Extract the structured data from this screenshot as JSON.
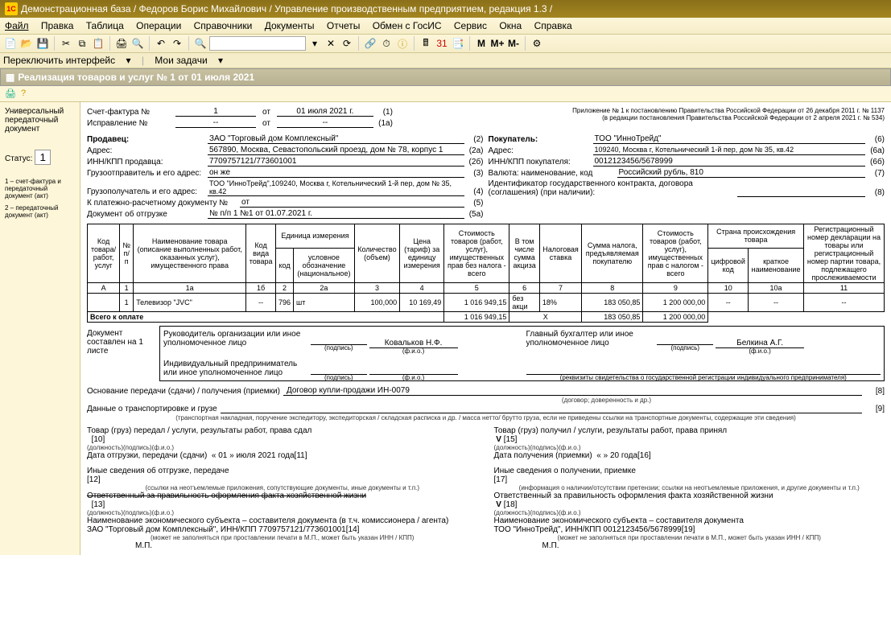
{
  "app_title": "Демонстрационная база / Федоров Борис Михайлович / Управление производственным предприятием, редакция 1.3 /",
  "menu": [
    "Файл",
    "Правка",
    "Таблица",
    "Операции",
    "Справочники",
    "Документы",
    "Отчеты",
    "Обмен с ГосИС",
    "Сервис",
    "Окна",
    "Справка"
  ],
  "tabs": {
    "a": "Переключить интерфейс",
    "b": "Мои задачи"
  },
  "form_title": "Реализация товаров и услуг № 1 от 01 июля 2021",
  "left": {
    "l1": "Универсальный передаточный документ",
    "status_lbl": "Статус:",
    "status_val": "1",
    "n1": "1 – счет-фактура и передаточный документ (акт)",
    "n2": "2 – передаточный документ (акт)"
  },
  "doc": {
    "appendix1": "Приложение № 1 к постановлению Правительства Российской Федерации от 26 декабря 2011 г. № 1137",
    "appendix2": "(в редакции постановления Правительства Российской Федерации от 2 апреля 2021 г. № 534)",
    "sf_lbl": "Счет-фактура №",
    "sf_no": "1",
    "sf_ot": "от",
    "sf_date": "01 июля 2021 г.",
    "sf_code": "(1)",
    "isp_lbl": "Исправление №",
    "isp_no": "--",
    "isp_ot": "от",
    "isp_date": "--",
    "isp_code": "(1а)",
    "seller_lbl": "Продавец:",
    "seller_val": "ЗАО \"Торговый дом Комплексный\"",
    "seller_code": "(2)",
    "addr_lbl": "Адрес:",
    "addr_val": "567890, Москва, Севастопольский проезд, дом № 78, корпус 1",
    "addr_code": "(2а)",
    "inn_lbl": "ИНН/КПП продавца:",
    "inn_val": "7709757121/773601001",
    "inn_code": "(2б)",
    "buyer_lbl": "Покупатель:",
    "buyer_val": "ТОО \"ИнноТрейд\"",
    "buyer_code": "(6)",
    "baddr_lbl": "Адрес:",
    "baddr_val": "109240, Москва г, Котельнический 1-й пер, дом № 35, кв.42",
    "baddr_code": "(6а)",
    "binn_lbl": "ИНН/КПП покупателя:",
    "binn_val": "0012123456/5678999",
    "binn_code": "(6б)",
    "go_lbl": "Грузоотправитель и его адрес:",
    "go_val": "он же",
    "go_code": "(3)",
    "gp_lbl": "Грузополучатель и его адрес:",
    "gp_val": "ТОО \"ИнноТрейд\",109240, Москва г, Котельнический 1-й пер, дом № 35, кв.42",
    "gp_code": "(4)",
    "pr_lbl": "К платежно-расчетному документу №",
    "pr_val": "от",
    "pr_code": "(5)",
    "ship_lbl": "Документ об отгрузке",
    "ship_val": "№ п/п 1 №1 от 01.07.2021 г.",
    "ship_code": "(5а)",
    "cur_lbl": "Валюта: наименование, код",
    "cur_val": "Российский рубль, 810",
    "cur_code": "(7)",
    "gov_lbl": "Идентификатор государственного контракта, договора (соглашения) (при наличии):",
    "gov_code": "(8)"
  },
  "hdr": {
    "c0": "Код товара/ работ, услуг",
    "c1": "№ п/п",
    "c1a": "Наименование товара (описание выполненных работ, оказанных услуг), имущественного права",
    "c1b": "Код вида товара",
    "c2g": "Единица измерения",
    "c2a": "код",
    "c2b": "условное обозначение (национальное)",
    "c3": "Количество (объем)",
    "c4": "Цена (тариф) за единицу измерения",
    "c5": "Стоимость товаров (работ, услуг), имущественных прав без налога - всего",
    "c6": "В том числе сумма акциза",
    "c7": "Налоговая ставка",
    "c8": "Сумма налога, предъявляемая покупателю",
    "c9": "Стоимость товаров (работ, услуг), имущественных прав с налогом - всего",
    "c10g": "Страна происхождения товара",
    "c10a": "цифровой код",
    "c10b": "краткое наименование",
    "c11": "Регистрационный номер декларации на товары или регистрационный номер партии товара, подлежащего прослеживаемости"
  },
  "nrow": {
    "a": "А",
    "n1": "1",
    "n1a": "1а",
    "n1b": "1б",
    "n2": "2",
    "n2a": "2а",
    "n3": "3",
    "n4": "4",
    "n5": "5",
    "n6": "6",
    "n7": "7",
    "n8": "8",
    "n9": "9",
    "n10": "10",
    "n10a": "10а",
    "n11": "11"
  },
  "row": {
    "c0": "",
    "c1": "1",
    "c1a": "Телевизор \"JVC\"",
    "c1b": "--",
    "c2": "796",
    "c2a": "шт",
    "c3": "100,000",
    "c4": "10 169,49",
    "c5": "1 016 949,15",
    "c6": "без акци",
    "c7": "18%",
    "c8": "183 050,85",
    "c9": "1 200 000,00",
    "c10": "--",
    "c10a": "--",
    "c11": "--"
  },
  "tot": {
    "lbl": "Всего к оплате",
    "c5": "1 016 949,15",
    "cx": "X",
    "c8": "183 050,85",
    "c9": "1 200 000,00"
  },
  "sig": {
    "doclbl": "Документ составлен на 1 листе",
    "r1": "Руководитель организации или иное уполномоченное лицо",
    "r1v": "Ковальков Н.Ф.",
    "r2": "Главный бухгалтер или иное уполномоченное лицо",
    "r2v": "Белкина А.Г.",
    "ip": "Индивидуальный предприниматель или иное уполномоченное лицо",
    "pod": "(подпись)",
    "fio": "(ф.и.о.)",
    "req": "(реквизиты свидетельства о государственной регистрации индивидуального предпринимателя)"
  },
  "bottom": {
    "osn_lbl": "Основание передачи (сдачи) / получения (приемки)",
    "osn_val": "Договор купли-продажи ИН-0079",
    "osn_note": "(договор; доверенность и др.)",
    "osn_code": "[8]",
    "trans_lbl": "Данные о транспортировке и грузе",
    "trans_code": "[9]",
    "trans_note": "(транспортная накладная, поручение экспедитору, экспедиторская / складская расписка и др. / масса нетто/ брутто груза, если не приведены ссылки на транспортные документы, содержащие эти сведения)",
    "left_title": "Товар (груз) передал / услуги, результаты работ, права сдал",
    "right_title": "Товар (груз) получил / услуги, результаты работ, права принял",
    "dol": "(должность)",
    "date_l": "Дата отгрузки, передачи (сдачи)",
    "date_l_val": "« 01 »    июля    2021  года",
    "date_l_code": "[11]",
    "date_r": "Дата получения (приемки)",
    "date_r_val": "«       »                20    года",
    "date_r_code": "[16]",
    "other_l": "Иные сведения об отгрузке, передаче",
    "other_l_note": "(ссылки на неотъемлемые приложения, сопутствующие документы, иные документы и т.п.)",
    "other_l_code": "[12]",
    "other_r": "Иные сведения о получении, приемке",
    "other_r_note": "(информация о наличии/отсутствии претензии; ссылки на неотъемлемые приложения, и другие документы и т.п.)",
    "other_r_code": "[17]",
    "resp_l": "Ответственный за правильность оформления факта хозяйственной жизни",
    "resp_l_code": "[13]",
    "resp_r": "Ответственный за правильность оформления факта хозяйственной жизни",
    "resp_r_code": "[18]",
    "name_l_lbl": "Наименование экономического субъекта – составителя документа (в т.ч. комиссионера / агента)",
    "name_l_val": "ЗАО \"Торговый дом Комплексный\", ИНН/КПП 7709757121/773601001",
    "name_l_code": "[14]",
    "name_r_lbl": "Наименование экономического субъекта – составителя документа",
    "name_r_val": "ТОО \"ИнноТрейд\", ИНН/КПП 0012123456/5678999",
    "name_r_code": "[19]",
    "mp": "М.П.",
    "mp_note": "(может не заполняться при проставлении печати в М.П., может быть указан ИНН / КПП)",
    "c10": "[10]",
    "c15": "[15]"
  }
}
